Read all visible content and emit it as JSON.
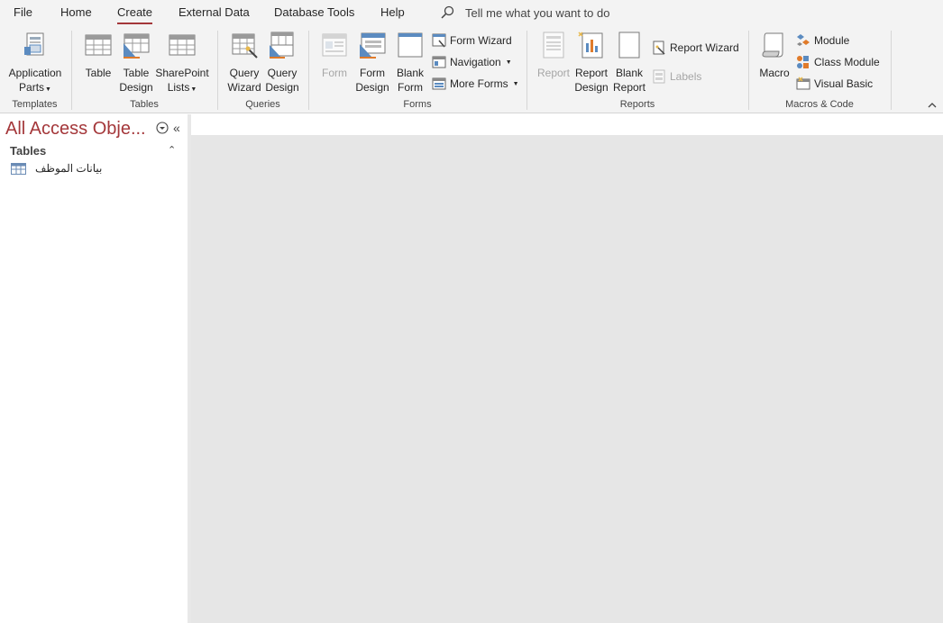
{
  "menu": {
    "tabs": [
      "File",
      "Home",
      "Create",
      "External Data",
      "Database Tools",
      "Help"
    ],
    "active_tab": "Create",
    "tell_me": "Tell me what you want to do"
  },
  "ribbon": {
    "groups": {
      "templates": "Templates",
      "tables": "Tables",
      "queries": "Queries",
      "forms": "Forms",
      "reports": "Reports",
      "macros": "Macros & Code"
    },
    "buttons": {
      "app_parts_1": "Application",
      "app_parts_2": "Parts",
      "table": "Table",
      "table_design_1": "Table",
      "table_design_2": "Design",
      "sharepoint_1": "SharePoint",
      "sharepoint_2": "Lists",
      "query_wizard_1": "Query",
      "query_wizard_2": "Wizard",
      "query_design_1": "Query",
      "query_design_2": "Design",
      "form": "Form",
      "form_design_1": "Form",
      "form_design_2": "Design",
      "blank_form_1": "Blank",
      "blank_form_2": "Form",
      "form_wizard": "Form Wizard",
      "navigation": "Navigation",
      "more_forms": "More Forms",
      "report": "Report",
      "report_design_1": "Report",
      "report_design_2": "Design",
      "blank_report_1": "Blank",
      "blank_report_2": "Report",
      "report_wizard": "Report Wizard",
      "labels": "Labels",
      "macro": "Macro",
      "module": "Module",
      "class_module": "Class Module",
      "visual_basic": "Visual Basic"
    }
  },
  "nav": {
    "title": "All Access Obje...",
    "section": "Tables",
    "items": [
      "بيانات الموظف"
    ]
  },
  "colors": {
    "accent": "#a4373a",
    "ribbon_bg": "#f3f3f3",
    "workspace_bg": "#e6e6e6"
  }
}
